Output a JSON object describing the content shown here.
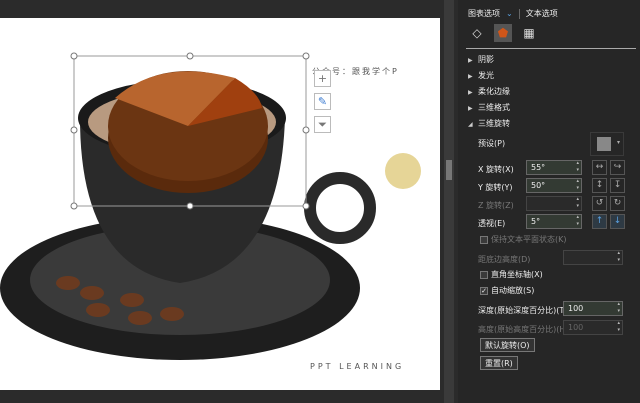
{
  "panel": {
    "tabs": [
      "图表选项",
      "文本选项"
    ],
    "sections": [
      "阴影",
      "发光",
      "柔化边缘",
      "三维格式",
      "三维旋转"
    ],
    "preset_label": "预设(P)",
    "x_rotation": {
      "label": "X 旋转(X)",
      "value": "55°"
    },
    "y_rotation": {
      "label": "Y 旋转(Y)",
      "value": "50°"
    },
    "z_rotation": {
      "label": "Z 旋转(Z)",
      "value": ""
    },
    "perspective": {
      "label": "透视(E)",
      "value": "5°"
    },
    "keep_text_flat": "保持文本平面状态(K)",
    "distance_from_ground": "距底边高度(D)",
    "right_angle_axes": "直角坐标轴(X)",
    "autoscale": "自动缩放(S)",
    "depth": {
      "label": "深度(原始深度百分比)(T)",
      "value": "100"
    },
    "height": {
      "label": "高度(原始高度百分比)(H)",
      "value": "100"
    },
    "default_rotation": "默认旋转(O)",
    "reset": "重置(R)"
  },
  "slide": {
    "watermark": "公众号：跟我学个P",
    "brand": "PPT LEARNING"
  },
  "colors": {
    "pie_main": "#6b3512",
    "pie_top": "#b8652e",
    "pie_slice": "#a0400f"
  }
}
